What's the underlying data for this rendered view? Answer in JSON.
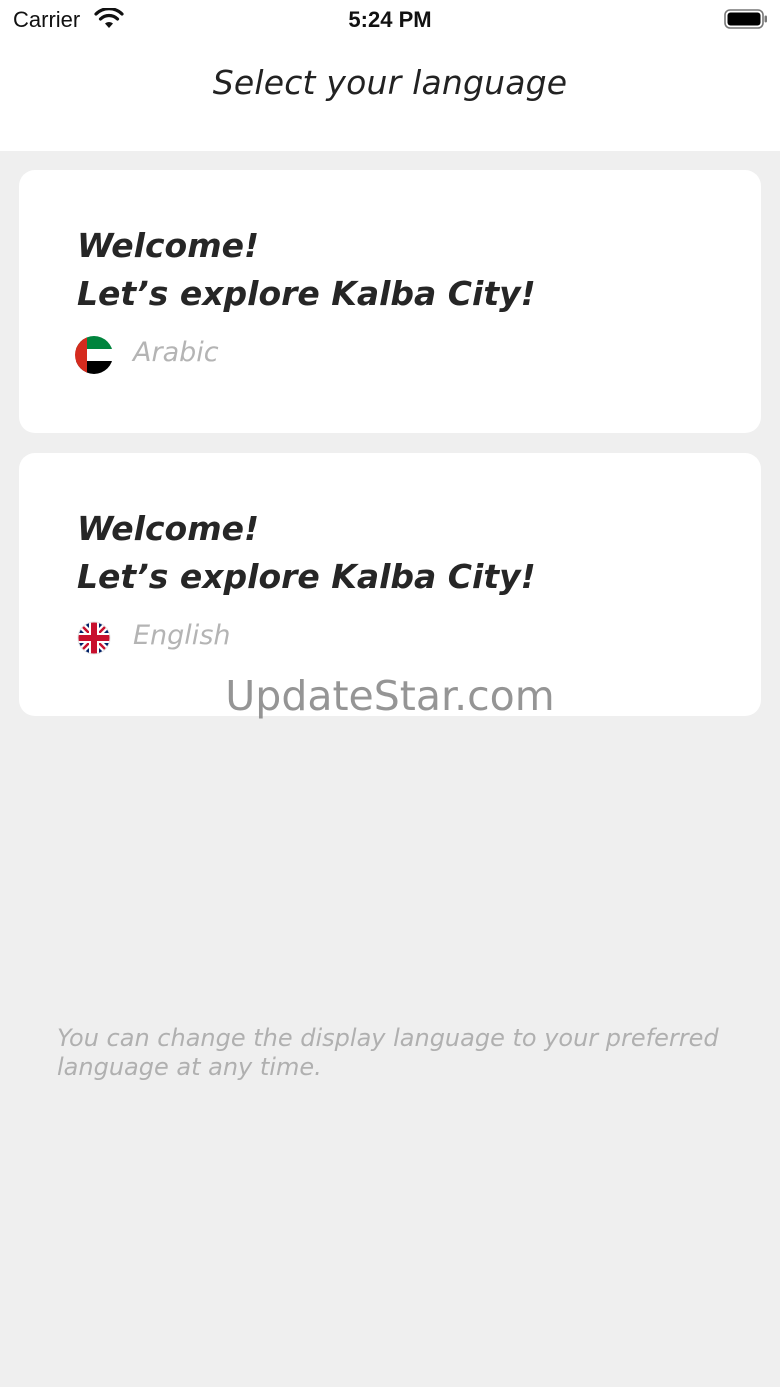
{
  "status_bar": {
    "carrier": "Carrier",
    "time": "5:24 PM"
  },
  "header": {
    "title": "Select your language"
  },
  "languages": [
    {
      "welcome_line1": "Welcome!",
      "welcome_line2": "Let’s explore Kalba City!",
      "label": "Arabic",
      "flag_icon": "uae-flag-icon"
    },
    {
      "welcome_line1": "Welcome!",
      "welcome_line2": "Let’s explore Kalba City!",
      "label": "English",
      "flag_icon": "uk-flag-icon"
    }
  ],
  "watermark": "UpdateStar.com",
  "footer_note": "You can change the display language to your preferred language at any time.",
  "colors": {
    "background": "#efefef",
    "card": "#ffffff",
    "title_text": "#222222",
    "muted_text": "#b4b4b4"
  }
}
